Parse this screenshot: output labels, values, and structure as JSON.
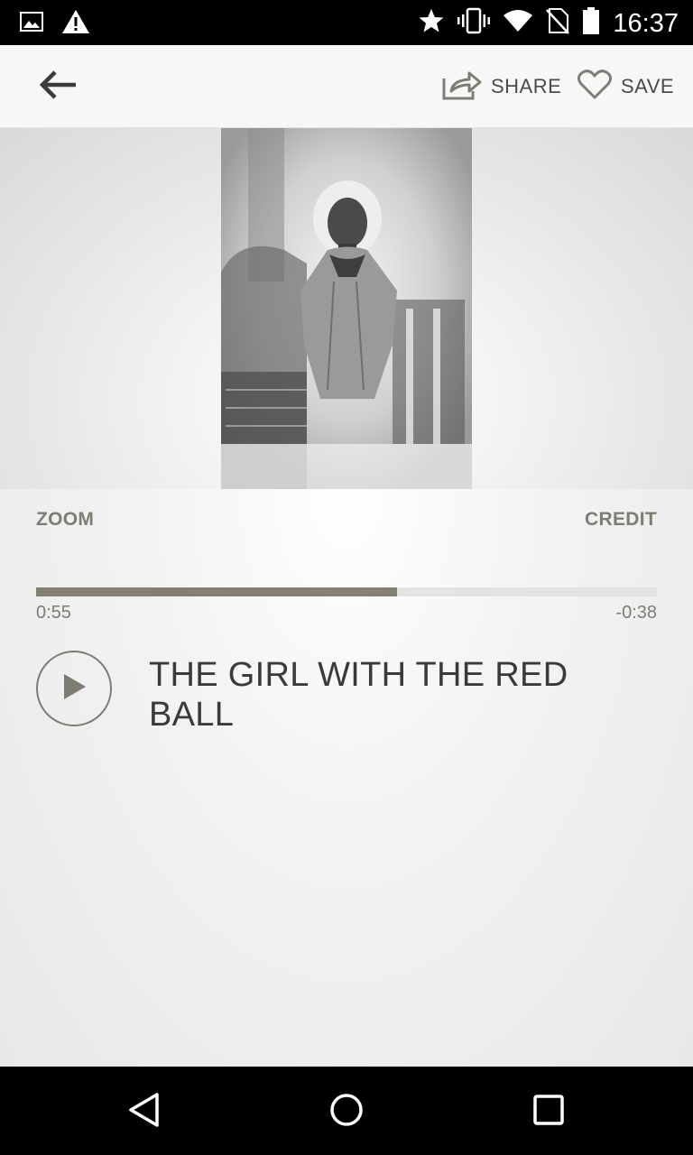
{
  "status_bar": {
    "time": "16:37",
    "left_icons": [
      "image-icon",
      "warning-icon"
    ],
    "right_icons": [
      "star-icon",
      "vibrate-icon",
      "wifi-icon",
      "no-sim-icon",
      "battery-icon"
    ]
  },
  "app_bar": {
    "back_icon": "arrow-left-icon",
    "share_label": "SHARE",
    "save_label": "SAVE"
  },
  "media": {
    "zoom_label": "ZOOM",
    "credit_label": "CREDIT",
    "elapsed": "0:55",
    "remaining": "-0:38",
    "progress_fraction": 0.581,
    "title": "THE GIRL WITH THE RED BALL"
  },
  "nav_bar": {
    "icons": [
      "back-triangle-icon",
      "home-circle-icon",
      "recents-square-icon"
    ]
  },
  "colors": {
    "accent": "#848073",
    "text_dark": "#3a3a3a",
    "text_muted": "#7f7c73"
  }
}
